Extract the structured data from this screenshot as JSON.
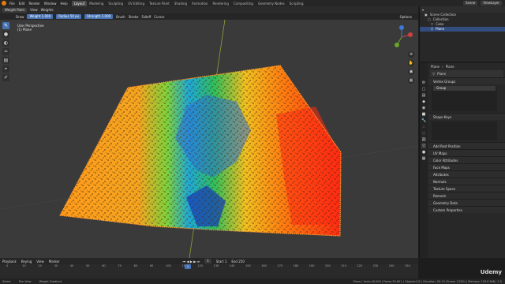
{
  "topbar": {
    "menus": [
      "File",
      "Edit",
      "Render",
      "Window",
      "Help"
    ],
    "workspaces": [
      "Layout",
      "Modeling",
      "Sculpting",
      "UV Editing",
      "Texture Paint",
      "Shading",
      "Animation",
      "Rendering",
      "Compositing",
      "Geometry Nodes",
      "Scripting"
    ],
    "active_workspace": "Layout",
    "scene": "Scene",
    "view_layer": "ViewLayer"
  },
  "header": {
    "mode": "Weight Paint",
    "view": "View",
    "weights": "Weights",
    "brush_name": "Draw",
    "weight_label": "Weight",
    "weight_value": "1.000",
    "radius_label": "Radius",
    "radius_value": "50 px",
    "strength_label": "Strength",
    "strength_value": "1.000",
    "brush": "Brush",
    "stroke": "Stroke",
    "falloff": "Falloff",
    "cursor": "Cursor",
    "options": "Options"
  },
  "viewport": {
    "view_name": "User Perspective",
    "object_name": "(1) Plane"
  },
  "outliner": {
    "title": "Scene Collection",
    "rows": [
      "Collection",
      "Cube",
      "Plane"
    ],
    "selected": "Plane"
  },
  "properties": {
    "object_name": "Plane",
    "data_name": "Plane",
    "vertex_groups_label": "Vertex Groups",
    "vertex_group_item": "Group",
    "shape_keys_label": "Shape Keys",
    "sections": [
      "Add Rest Position",
      "UV Maps",
      "Color Attributes",
      "Face Maps",
      "Attributes",
      "Normals",
      "Texture Space",
      "Remesh",
      "Geometry Data",
      "Custom Properties"
    ]
  },
  "timeline": {
    "playback": "Playback",
    "keying": "Keying",
    "view": "View",
    "marker": "Marker",
    "current_frame": "1",
    "start_label": "Start",
    "start": "1",
    "end_label": "End",
    "end": "250",
    "ticks": [
      "0",
      "10",
      "20",
      "30",
      "40",
      "50",
      "60",
      "70",
      "80",
      "90",
      "100",
      "110",
      "120",
      "130",
      "140",
      "150",
      "160",
      "170",
      "180",
      "190",
      "200",
      "210",
      "220",
      "230",
      "240",
      "250"
    ]
  },
  "statusbar": {
    "select": "Select",
    "pan_view": "Pan View",
    "weight_gradient": "Weight Gradient",
    "stats": "Plane | Verts:40,000 | Faces:39,601 | Objects:0/2 | Duration: 00:10 (Frame 1/250) | Memory: 103.8 MiB | 3.5"
  },
  "watermark": "Udemy",
  "colors": {
    "accent": "#4772b3",
    "orange": "#e87d0d"
  }
}
